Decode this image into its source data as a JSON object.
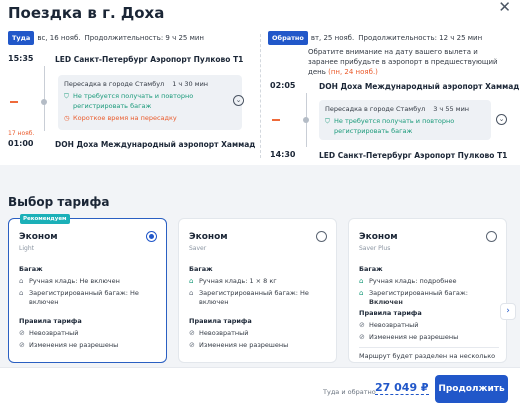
{
  "header": {
    "title": "Поездка в г. Доха"
  },
  "outbound": {
    "chip": "Туда",
    "date": "вс, 16 нояб.",
    "duration": "Продолжительность: 9 ч 25 мин",
    "depart_time": "15:35",
    "depart_airport": "LED Санкт-Петербург Аэропорт Пулково Т1",
    "transfer": {
      "city": "Пересадка в городе Стамбул",
      "duration": "1 ч 30 мин",
      "visa_note": "Не требуется получать и повторно регистрировать багаж",
      "warning": "Короткое время на пересадку"
    },
    "arrive_date_note": "17 нояб.",
    "arrive_time": "01:00",
    "arrive_airport": "DOH Доха Международный аэропорт Хаммад"
  },
  "inbound": {
    "chip": "Обратно",
    "date": "вт, 25 нояб.",
    "duration": "Продолжительность: 12 ч 25 мин",
    "notice": "Обратите внимание на дату вашего вылета и заранее прибудьте в аэропорт в предшествующий день",
    "notice_late": "(пн, 24 нояб.)",
    "depart_time": "02:05",
    "depart_airport": "DOH Доха Международный аэропорт Хаммад",
    "transfer": {
      "city": "Пересадка в городе Стамбул",
      "duration": "3 ч 55 мин",
      "visa_note": "Не требуется получать и повторно регистрировать багаж"
    },
    "arrive_time": "14:30",
    "arrive_airport": "LED Санкт-Петербург Аэропорт Пулково Т1"
  },
  "tariffs": {
    "title": "Выбор тарифа",
    "cards": [
      {
        "badge": "Рекомендуем",
        "name": "Эконом",
        "sub": "Light",
        "selected": true,
        "baggage_title": "Багаж",
        "hand": "Ручная кладь: Не включен",
        "checked": "Зарегистрированный багаж: Не включен",
        "rules_title": "Правила тарифа",
        "rule1": "Невозвратный",
        "rule2": "Изменения не разрешены"
      },
      {
        "name": "Эконом",
        "sub": "Saver",
        "selected": false,
        "baggage_title": "Багаж",
        "hand": "Ручная кладь: 1 × 8 кг",
        "checked": "Зарегистрированный багаж: Не включен",
        "rules_title": "Правила тарифа",
        "rule1": "Невозвратный",
        "rule2": "Изменения не разрешены"
      },
      {
        "name": "Эконом",
        "sub": "Saver Plus",
        "selected": false,
        "baggage_title": "Багаж",
        "hand": "Ручная кладь: подробнее",
        "checked_prefix": "Зарегистрированный багаж:",
        "checked_value": "Включен",
        "rules_title": "Правила тарифа",
        "rule1": "Невозвратный",
        "rule2": "Изменения не разрешены",
        "info": "Маршрут будет разделен на несколько"
      }
    ]
  },
  "footer": {
    "price_label": "Туда и обратно",
    "price": "27 049 ₽",
    "cta": "Продолжить"
  },
  "icons": {
    "close": "close-icon",
    "expand": "chevron-down-icon",
    "next": "chevron-right-icon",
    "bag": "bag-icon",
    "shield": "shield-check-icon",
    "clock": "clock-icon",
    "no": "circle-slash-icon"
  },
  "colors": {
    "accent": "#2157c9",
    "warning": "#ea5b2c",
    "ok": "#1a9a7a",
    "badge": "#1bb0b8"
  }
}
